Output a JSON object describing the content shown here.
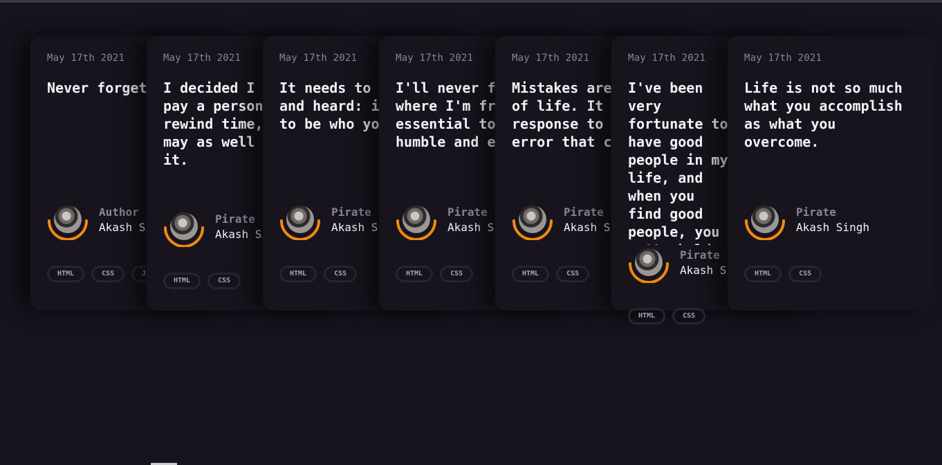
{
  "cards": [
    {
      "date": "May 17th 2021",
      "quote": "Never forget that you are",
      "role": "Author",
      "name": "Akash Singh",
      "tags": [
        "HTML",
        "CSS",
        "JS"
      ]
    },
    {
      "date": "May 17th 2021",
      "quote": "I decided I would pay a person to rewind time, so I may as well enjoy it.",
      "role": "Pirate",
      "name": "Akash Singh",
      "tags": [
        "HTML",
        "CSS"
      ]
    },
    {
      "date": "May 17th 2021",
      "quote": "It needs to be seen and heard: it's okay to be who you are",
      "role": "Pirate",
      "name": "Akash Singh",
      "tags": [
        "HTML",
        "CSS"
      ]
    },
    {
      "date": "May 17th 2021",
      "quote": "I'll never forget where I'm from. It's essential to stay humble and evolving",
      "role": "Pirate",
      "name": "Akash Singh",
      "tags": [
        "HTML",
        "CSS"
      ]
    },
    {
      "date": "May 17th 2021",
      "quote": "Mistakes are a part of life. It is the response to the error that counts",
      "role": "Pirate",
      "name": "Akash Singh",
      "tags": [
        "HTML",
        "CSS"
      ]
    },
    {
      "date": "May 17th 2021",
      "quote": "I've been very fortunate to have good people in my life, and when you find good people, you gotta hold on to them real tight",
      "role": "Pirate",
      "name": "Akash Singh",
      "tags": [
        "HTML",
        "CSS"
      ]
    },
    {
      "date": "May 17th 2021",
      "quote": "Life is not so much what you accomplish as what you overcome.",
      "role": "Pirate",
      "name": "Akash Singh",
      "tags": [
        "HTML",
        "CSS"
      ]
    }
  ],
  "colors": {
    "accent": "#f08a0c",
    "background": "#17141d",
    "tag_border": "#28252f"
  }
}
